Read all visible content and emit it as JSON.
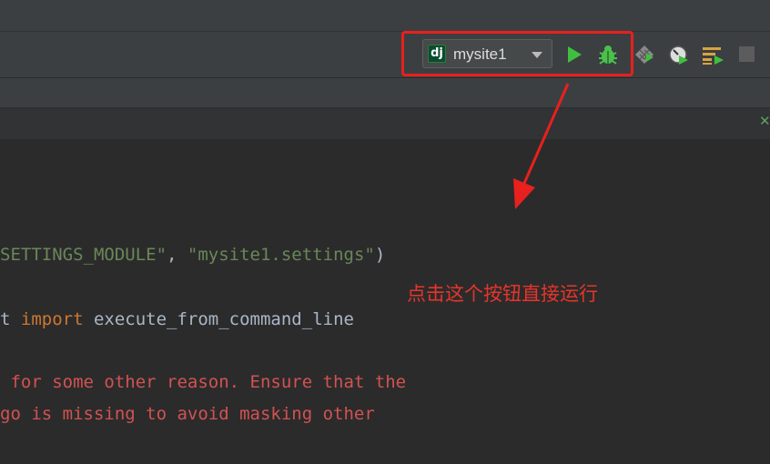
{
  "toolbar": {
    "run_config": {
      "icon": "django-icon",
      "icon_text": "dj",
      "label": "mysite1"
    },
    "icons": [
      "run-icon",
      "debug-icon",
      "coverage-icon",
      "profile-icon",
      "concurrency-icon",
      "stop-icon"
    ]
  },
  "annotation": {
    "text": "点击这个按钮直接运行",
    "color": "#e8342a"
  },
  "highlight_color": "#e8201e",
  "code": {
    "line1": {
      "a": "SETTINGS_MODULE\"",
      "b": ", ",
      "c": "\"mysite1.settings\"",
      "d": ")"
    },
    "line2": {
      "a": "t ",
      "b": "import",
      "c": " execute_from_command_line"
    },
    "line3": " for some other reason. Ensure that the",
    "line4": "go is missing to avoid masking other"
  }
}
